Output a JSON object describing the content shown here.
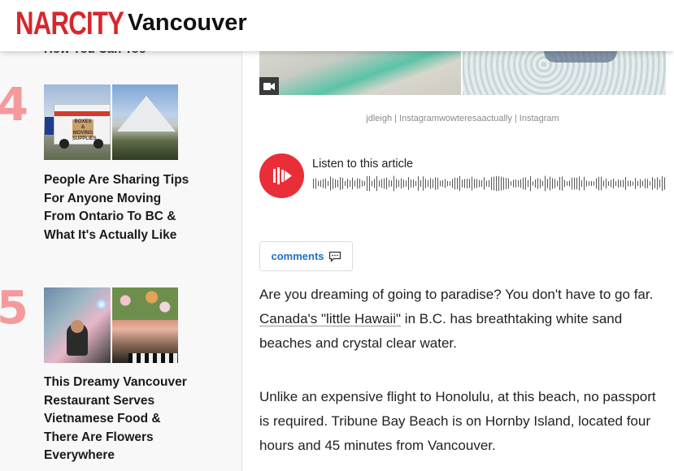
{
  "header": {
    "logo": "NARCITY",
    "city": "Vancouver"
  },
  "sidebar": {
    "cut_title": "How You Can Too",
    "items": [
      {
        "rank": "4",
        "title": "People Are Sharing Tips For Anyone Moving From Ontario To BC & What It's Actually Like",
        "truck_text": "BOXES & MOVING SUPPLIES"
      },
      {
        "rank": "5",
        "title": "This Dreamy Vancouver Restaurant Serves Vietnamese Food & There Are Flowers Everywhere"
      }
    ]
  },
  "article": {
    "photo_credit": "jdleigh | Instagramwowteresaactually | Instagram",
    "listen_label": "Listen to this article",
    "comments_label": "comments",
    "paragraph1_a": "Are you dreaming of going to paradise? You don't have to go far. ",
    "paragraph1_link": "Canada's \"little Hawaii\"",
    "paragraph1_b": " in B.C. has breathtaking white sand beaches and crystal clear water.",
    "paragraph2": "Unlike an expensive flight to Honolulu, at this beach, no passport is required. Tribune Bay Beach is on Hornby Island, located four hours and 45 minutes from Vancouver."
  },
  "colors": {
    "brand_red": "#d8262d",
    "rank_pink": "#f49a9d",
    "link_blue": "#1d70c9",
    "audio_red": "#ea2e38"
  },
  "icons": [
    "video-icon",
    "audio-play-icon",
    "comment-bubble-icon"
  ]
}
